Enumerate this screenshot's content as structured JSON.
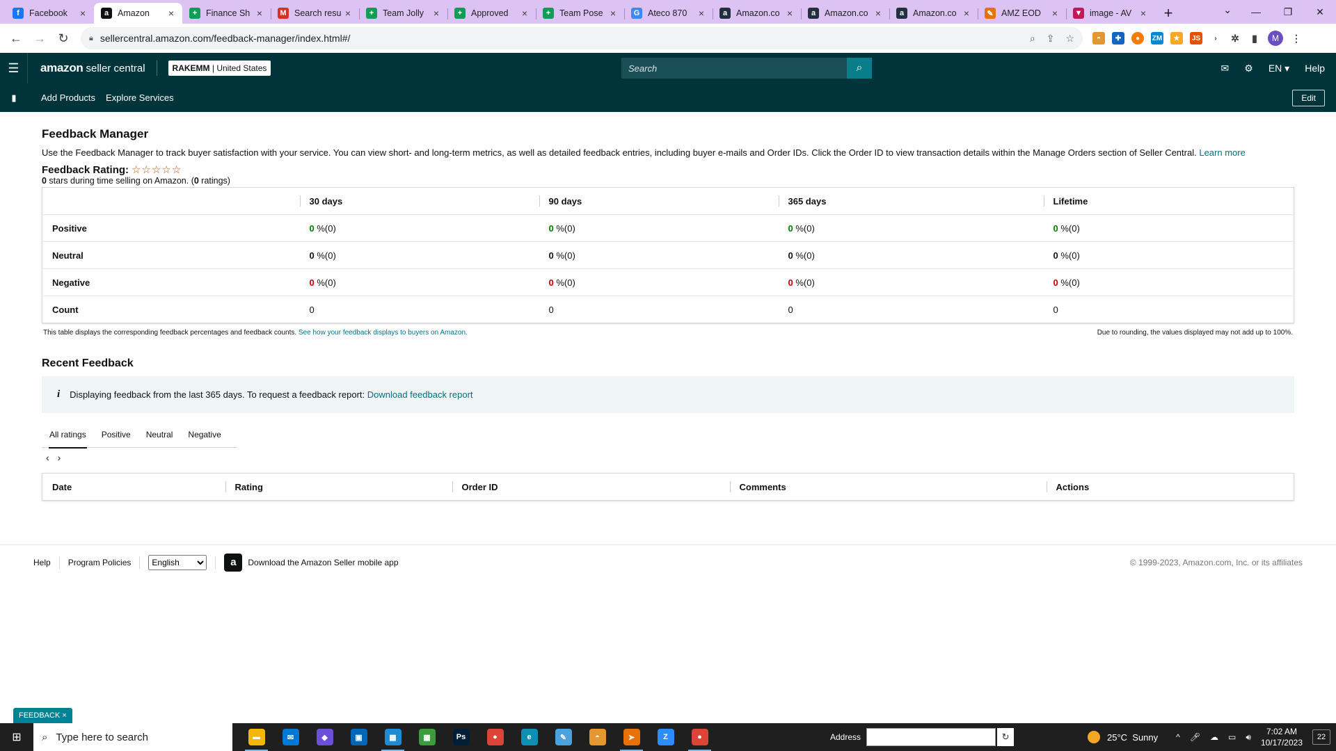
{
  "browser": {
    "tabs": [
      {
        "title": "Facebook",
        "icon": "facebook-icon",
        "color": "#1877f2",
        "glyph": "f"
      },
      {
        "title": "Amazon",
        "icon": "amazon-icon",
        "color": "#0f1111",
        "glyph": "a",
        "active": true
      },
      {
        "title": "Finance Sh",
        "icon": "google-sheets-icon",
        "color": "#0f9d58",
        "glyph": "+"
      },
      {
        "title": "Search resu",
        "icon": "gmail-icon",
        "color": "#d93025",
        "glyph": "M"
      },
      {
        "title": "Team Jolly",
        "icon": "google-sheets-icon",
        "color": "#0f9d58",
        "glyph": "+"
      },
      {
        "title": "Approved",
        "icon": "google-sheets-icon",
        "color": "#0f9d58",
        "glyph": "+"
      },
      {
        "title": "Team Pose",
        "icon": "google-sheets-icon",
        "color": "#0f9d58",
        "glyph": "+"
      },
      {
        "title": "Ateco 870",
        "icon": "google-icon",
        "color": "#4285f4",
        "glyph": "G"
      },
      {
        "title": "Amazon.co",
        "icon": "amazon-icon",
        "color": "#232f3e",
        "glyph": "a"
      },
      {
        "title": "Amazon.co",
        "icon": "amazon-icon",
        "color": "#232f3e",
        "glyph": "a"
      },
      {
        "title": "Amazon.co",
        "icon": "amazon-icon",
        "color": "#232f3e",
        "glyph": "a"
      },
      {
        "title": "AMZ EOD",
        "icon": "amz-eod-icon",
        "color": "#e8710a",
        "glyph": "✎"
      },
      {
        "title": "image - AV",
        "icon": "image-icon",
        "color": "#c2185b",
        "glyph": "▼"
      }
    ],
    "url": "sellercentral.amazon.com/feedback-manager/index.html#/"
  },
  "header": {
    "logo_brand": "amazon",
    "logo_product": "seller central",
    "account_name": "RAKEMM",
    "account_region": "United States",
    "search_placeholder": "Search",
    "language": "EN",
    "help": "Help"
  },
  "nav": {
    "items": [
      "Add Products",
      "Explore Services"
    ],
    "edit": "Edit"
  },
  "page": {
    "title": "Feedback Manager",
    "intro": "Use the Feedback Manager to track buyer satisfaction with your service. You can view short- and long-term metrics, as well as detailed feedback entries, including buyer e-mails and Order IDs. Click the Order ID to view transaction details within the Manage Orders section of Seller Central.",
    "learn_more": "Learn more",
    "rating_label": "Feedback Rating:",
    "stars_display": "☆☆☆☆☆",
    "rating_value": "0",
    "rating_text": " stars during time selling on Amazon. (",
    "rating_count": "0",
    "rating_suffix": " ratings)"
  },
  "metrics": {
    "columns": [
      "30 days",
      "90 days",
      "365 days",
      "Lifetime"
    ],
    "rows": [
      {
        "label": "Positive",
        "type": "pos",
        "values": [
          {
            "pct": "0",
            "cnt": " %(0)"
          },
          {
            "pct": "0",
            "cnt": " %(0)"
          },
          {
            "pct": "0",
            "cnt": " %(0)"
          },
          {
            "pct": "0",
            "cnt": " %(0)"
          }
        ]
      },
      {
        "label": "Neutral",
        "type": "neu",
        "values": [
          {
            "pct": "0",
            "cnt": " %(0)"
          },
          {
            "pct": "0",
            "cnt": " %(0)"
          },
          {
            "pct": "0",
            "cnt": " %(0)"
          },
          {
            "pct": "0",
            "cnt": " %(0)"
          }
        ]
      },
      {
        "label": "Negative",
        "type": "neg",
        "values": [
          {
            "pct": "0",
            "cnt": " %(0)"
          },
          {
            "pct": "0",
            "cnt": " %(0)"
          },
          {
            "pct": "0",
            "cnt": " %(0)"
          },
          {
            "pct": "0",
            "cnt": " %(0)"
          }
        ]
      }
    ],
    "count_label": "Count",
    "counts": [
      "0",
      "0",
      "0",
      "0"
    ],
    "note_left": "This table displays the corresponding feedback percentages and feedback counts.",
    "note_link": "See how your feedback displays to buyers on Amazon.",
    "note_right": "Due to rounding, the values displayed may not add up to 100%."
  },
  "recent": {
    "title": "Recent Feedback",
    "info_text": "Displaying feedback from the last 365 days. To request a feedback report:",
    "info_link": "Download feedback report",
    "tabs": [
      "All ratings",
      "Positive",
      "Neutral",
      "Negative"
    ],
    "columns": [
      "Date",
      "Rating",
      "Order ID",
      "Comments",
      "Actions"
    ]
  },
  "footer": {
    "help": "Help",
    "policies": "Program Policies",
    "language": "English",
    "app_text": "Download the Amazon Seller mobile app",
    "copyright": "© 1999-2023, Amazon.com, Inc. or its affiliates"
  },
  "feedback_button": "FEEDBACK",
  "taskbar": {
    "search_placeholder": "Type here to search",
    "address_label": "Address",
    "weather_temp": "25°C",
    "weather_text": "Sunny",
    "time": "7:02 AM",
    "date": "10/17/2023",
    "notifications": "22",
    "apps": [
      {
        "name": "file-explorer-icon",
        "color": "#f2b705",
        "glyph": "▬"
      },
      {
        "name": "mail-icon",
        "color": "#0078d4",
        "glyph": "✉"
      },
      {
        "name": "copilot-icon",
        "color": "#6b4fd8",
        "glyph": "◆"
      },
      {
        "name": "store-icon",
        "color": "#0067b8",
        "glyph": "▣"
      },
      {
        "name": "calculator-icon",
        "color": "#1e8cd3",
        "glyph": "▦"
      },
      {
        "name": "calculator-icon",
        "color": "#3c9b3c",
        "glyph": "▦"
      },
      {
        "name": "photoshop-icon",
        "color": "#001e36",
        "glyph": "Ps"
      },
      {
        "name": "chrome-icon",
        "color": "#db4437",
        "glyph": "●"
      },
      {
        "name": "edge-icon",
        "color": "#0c8fb3",
        "glyph": "e"
      },
      {
        "name": "notepad-icon",
        "color": "#4aa3df",
        "glyph": "✎"
      },
      {
        "name": "basket-icon",
        "color": "#e5962f",
        "glyph": "◓"
      },
      {
        "name": "telegram-icon",
        "color": "#e8710a",
        "glyph": "➤"
      },
      {
        "name": "zoom-icon",
        "color": "#2d8cff",
        "glyph": "Z"
      },
      {
        "name": "chrome-profile-icon",
        "color": "#db4437",
        "glyph": "●"
      }
    ]
  }
}
